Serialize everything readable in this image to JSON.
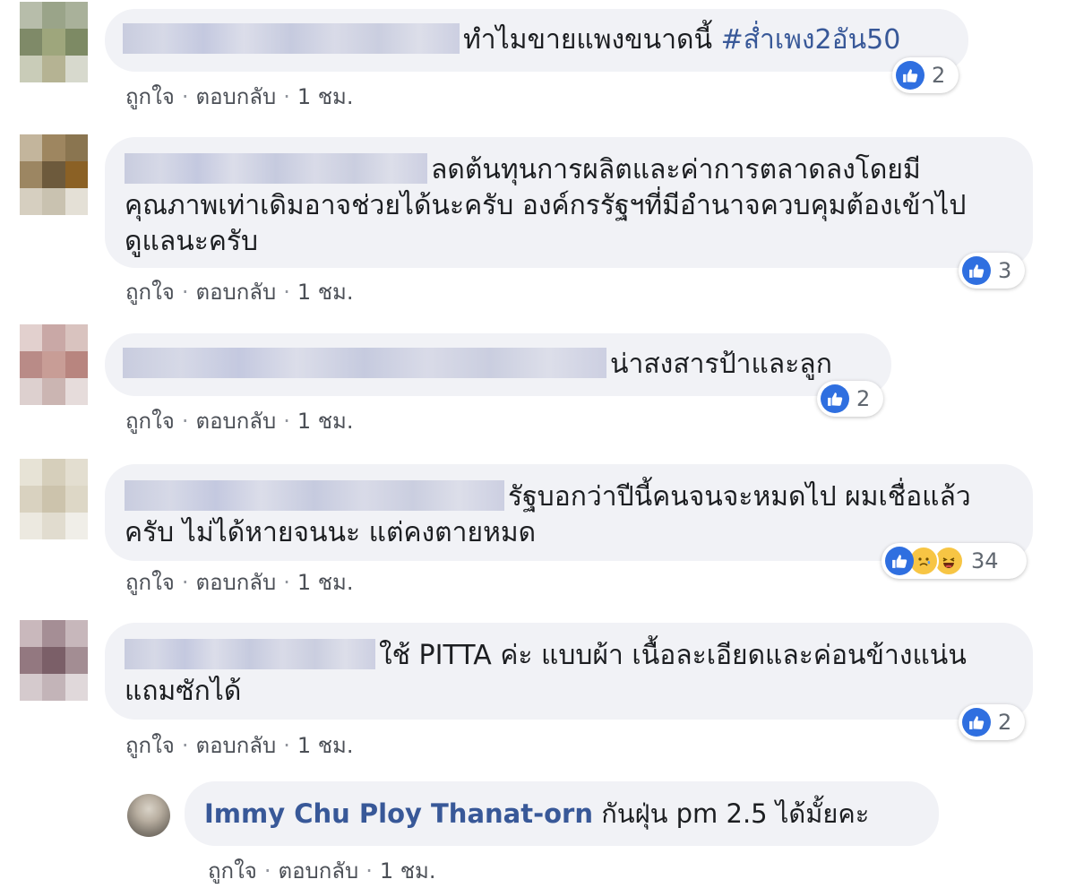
{
  "colors": {
    "bubble": "#f1f2f6",
    "link": "#385898",
    "like": "#2f6fe0",
    "meta": "#4b4f56"
  },
  "comments": [
    {
      "text": "ทำไมขายแพงขนาดนี้ ",
      "hashtag": "#ส่ำเพง2อัน50",
      "reaction_icons": [
        "like-icon"
      ],
      "reaction_count": "2",
      "actions": {
        "like": "ถูกใจ",
        "reply": "ตอบกลับ",
        "time": "1 ชม."
      }
    },
    {
      "text": "ลดต้นทุนการผลิตและค่าการตลาดลงโดยมีคุณภาพเท่าเดิมอาจช่วยได้นะครับ องค์กรรัฐฯที่มีอำนาจควบคุมต้องเข้าไปดูแลนะครับ",
      "reaction_icons": [
        "like-icon"
      ],
      "reaction_count": "3",
      "actions": {
        "like": "ถูกใจ",
        "reply": "ตอบกลับ",
        "time": "1 ชม."
      }
    },
    {
      "text": "น่าสงสารป้าและลูก",
      "reaction_icons": [
        "like-icon"
      ],
      "reaction_count": "2",
      "actions": {
        "like": "ถูกใจ",
        "reply": "ตอบกลับ",
        "time": "1 ชม."
      }
    },
    {
      "text": "รัฐบอกว่าปีนี้คนจนจะหมดไป ผมเชื่อแล้วครับ ไม่ได้หายจนนะ แต่คงตายหมด",
      "reaction_icons": [
        "like-icon",
        "sad-icon",
        "haha-icon"
      ],
      "reaction_count": "34",
      "actions": {
        "like": "ถูกใจ",
        "reply": "ตอบกลับ",
        "time": "1 ชม."
      }
    },
    {
      "text": "ใช้ PITTA ค่ะ แบบผ้า เนื้อละเอียดและค่อนข้างแน่น แถมซักได้",
      "reaction_icons": [
        "like-icon"
      ],
      "reaction_count": "2",
      "actions": {
        "like": "ถูกใจ",
        "reply": "ตอบกลับ",
        "time": "1 ชม."
      }
    }
  ],
  "reply": {
    "name": "Immy Chu Ploy Thanat-orn",
    "text": " กันฝุ่น pm 2.5 ได้มั้ยคะ",
    "actions": {
      "like": "ถูกใจ",
      "reply": "ตอบกลับ",
      "time": "1 ชม."
    }
  }
}
